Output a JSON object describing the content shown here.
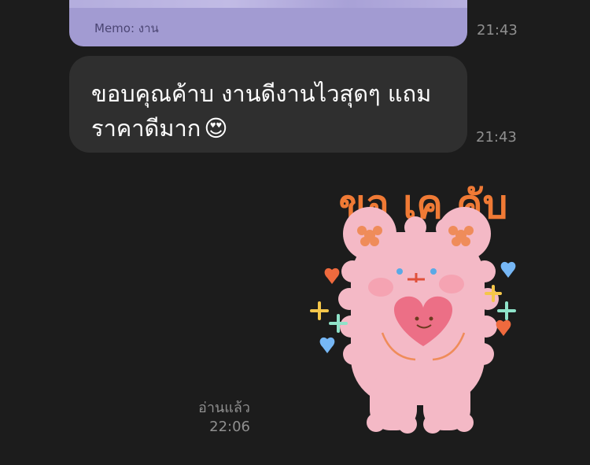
{
  "messages": {
    "image_card": {
      "memo": "Memo: งาน",
      "time": "21:43"
    },
    "text_bubble": {
      "line1": "ขอบคุณค้าบ งานดีงานไวสุดๆ แถม",
      "line2": "ราคาดีมาก",
      "emoji": "😍",
      "time": "21:43"
    },
    "sticker": {
      "caption": "ขอ เค คับ",
      "read_status": "อ่านแล้ว",
      "time": "22:06"
    }
  },
  "colors": {
    "background": "#1c1c1c",
    "bubble": "#2f2f2f",
    "image_card": "#a29bd2",
    "timestamp": "#8f8f8f",
    "bear": "#f4b9c6",
    "caption": "#f07a35"
  }
}
